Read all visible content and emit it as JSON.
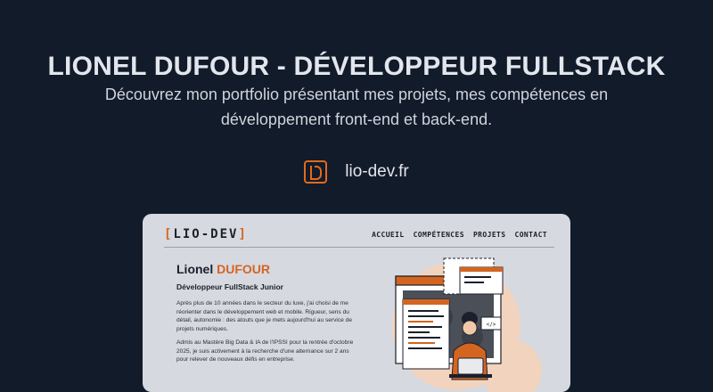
{
  "header": {
    "title": "LIONEL DUFOUR - DÉVELOPPEUR FULLSTACK",
    "subtitle": "Découvrez mon portfolio présentant mes projets, mes compétences en développement front-end et back-end."
  },
  "site": {
    "url": "lio-dev.fr",
    "logo_icon": "lio-dev-logo-icon"
  },
  "preview": {
    "brand_open": "[",
    "brand_text": "LIO-DEV",
    "brand_close": "]",
    "nav": [
      "ACCUEIL",
      "COMPÉTENCES",
      "PROJETS",
      "CONTACT"
    ],
    "first_name": "Lionel",
    "last_name": "DUFOUR",
    "role": "Développeur FullStack Junior",
    "paragraphs": [
      "Après plus de 10 années dans le secteur du luxe, j'ai choisi de me réorienter dans le développement web et mobile. Rigueur, sens du détail, autonomie : des atouts que je mets aujourd'hui au service de projets numériques.",
      "Admis au Mastère Big Data & IA de l'IPSSI pour la rentrée d'octobre 2025, je suis activement à la recherche d'une alternance sur 2 ans pour relever de nouveaux défis en entreprise."
    ],
    "illustration_code_tag": "</>"
  },
  "colors": {
    "background": "#121b2a",
    "accent": "#d46521",
    "preview_bg": "#d7d9e0"
  }
}
